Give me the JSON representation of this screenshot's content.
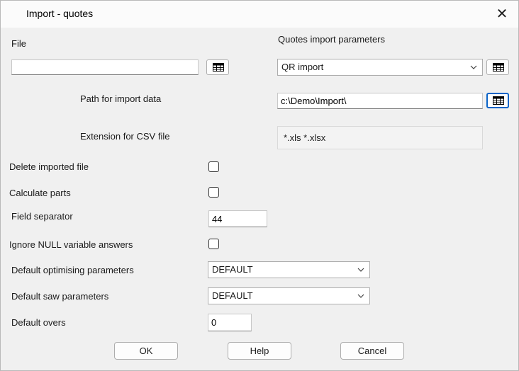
{
  "window": {
    "title": "Import - quotes",
    "close_glyph": "✕"
  },
  "file": {
    "label": "File",
    "value": "",
    "browse_icon": "table-icon"
  },
  "quotes_params": {
    "label": "Quotes import parameters",
    "selected": "QR import",
    "browse_icon": "table-icon"
  },
  "path": {
    "label": "Path for import data",
    "value": "c:\\Demo\\Import\\"
  },
  "csv": {
    "label": "Extension for CSV file",
    "value": "*.xls *.xlsx"
  },
  "delete_imported": {
    "label": "Delete imported file",
    "checked": false
  },
  "calculate_parts": {
    "label": "Calculate parts",
    "checked": false
  },
  "field_separator": {
    "label": "Field separator",
    "value": "44"
  },
  "ignore_null": {
    "label": "Ignore NULL variable answers",
    "checked": false
  },
  "default_optimising": {
    "label": "Default optimising parameters",
    "selected": "DEFAULT"
  },
  "default_saw": {
    "label": "Default saw parameters",
    "selected": "DEFAULT"
  },
  "default_overs": {
    "label": "Default overs",
    "value": "0"
  },
  "buttons": {
    "ok": "OK",
    "help": "Help",
    "cancel": "Cancel"
  }
}
